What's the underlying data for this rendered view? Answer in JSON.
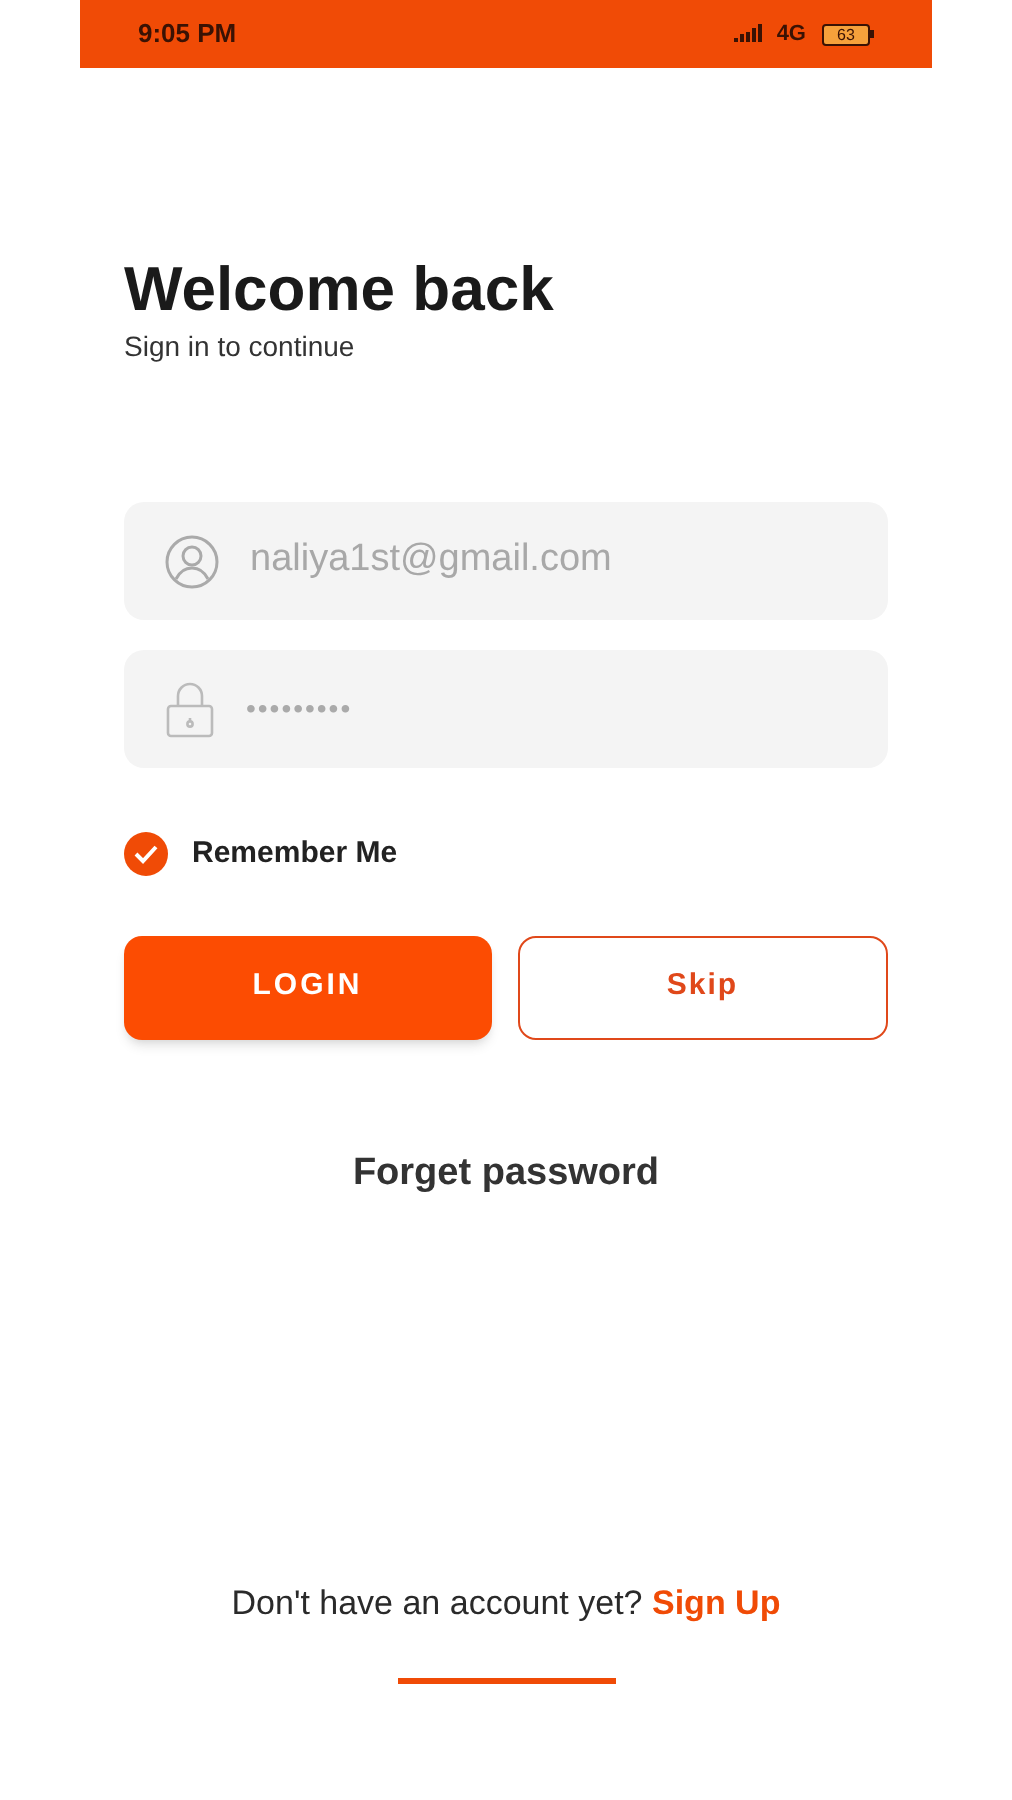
{
  "status_bar": {
    "time": "9:05 PM",
    "network": "4G",
    "battery": "63"
  },
  "title": "Welcome back",
  "subtitle": "Sign in to continue",
  "email_field": {
    "value": "naliya1st@gmail.com"
  },
  "password_field": {
    "value": "•••••••••"
  },
  "remember_me": {
    "label": "Remember Me",
    "checked": true
  },
  "buttons": [
    {
      "label": "LOGIN",
      "kind": "primary"
    },
    {
      "label": "Skip",
      "kind": "outline"
    }
  ],
  "forgot_link": "Forget password",
  "signup": {
    "prompt": "Don't have an account yet?",
    "link": "Sign Up"
  }
}
